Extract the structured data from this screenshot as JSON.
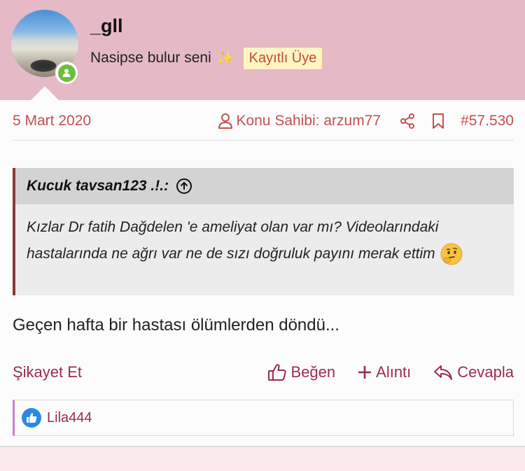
{
  "user": {
    "name": "_gll",
    "tagline": "Nasipse bulur seni",
    "badge": "Kayıtlı Üye",
    "status": "online"
  },
  "post": {
    "date": "5 Mart 2020",
    "owner_label": "Konu Sahibi: arzum77",
    "post_number": "#57.530",
    "quote": {
      "author": "Kucuk tavsan123 .!.:",
      "text": "Kızlar Dr fatih Dağdelen 'e ameliyat olan var mı? Videolarındaki hastalarında ne ağrı var ne de sızı doğruluk payını merak ettim"
    },
    "message": "Geçen hafta bir hastası ölümlerden döndü..."
  },
  "actions": {
    "report": "Şikayet Et",
    "like": "Beğen",
    "quote": "Alıntı",
    "reply": "Cevapla"
  },
  "reactions": {
    "users": "Lila444"
  },
  "colors": {
    "header_bg": "#e5b9c6",
    "accent": "#c35050",
    "action": "#9b2c4c",
    "badge_bg": "#fff4c4",
    "online": "#6dbf3b",
    "like": "#2a8ae3"
  },
  "icons": [
    "user-icon",
    "share-icon",
    "bookmark-icon",
    "arrow-up-circle-icon",
    "thinking-emoji",
    "thumbs-up-icon",
    "plus-icon",
    "reply-icon",
    "sparkle-icon"
  ]
}
